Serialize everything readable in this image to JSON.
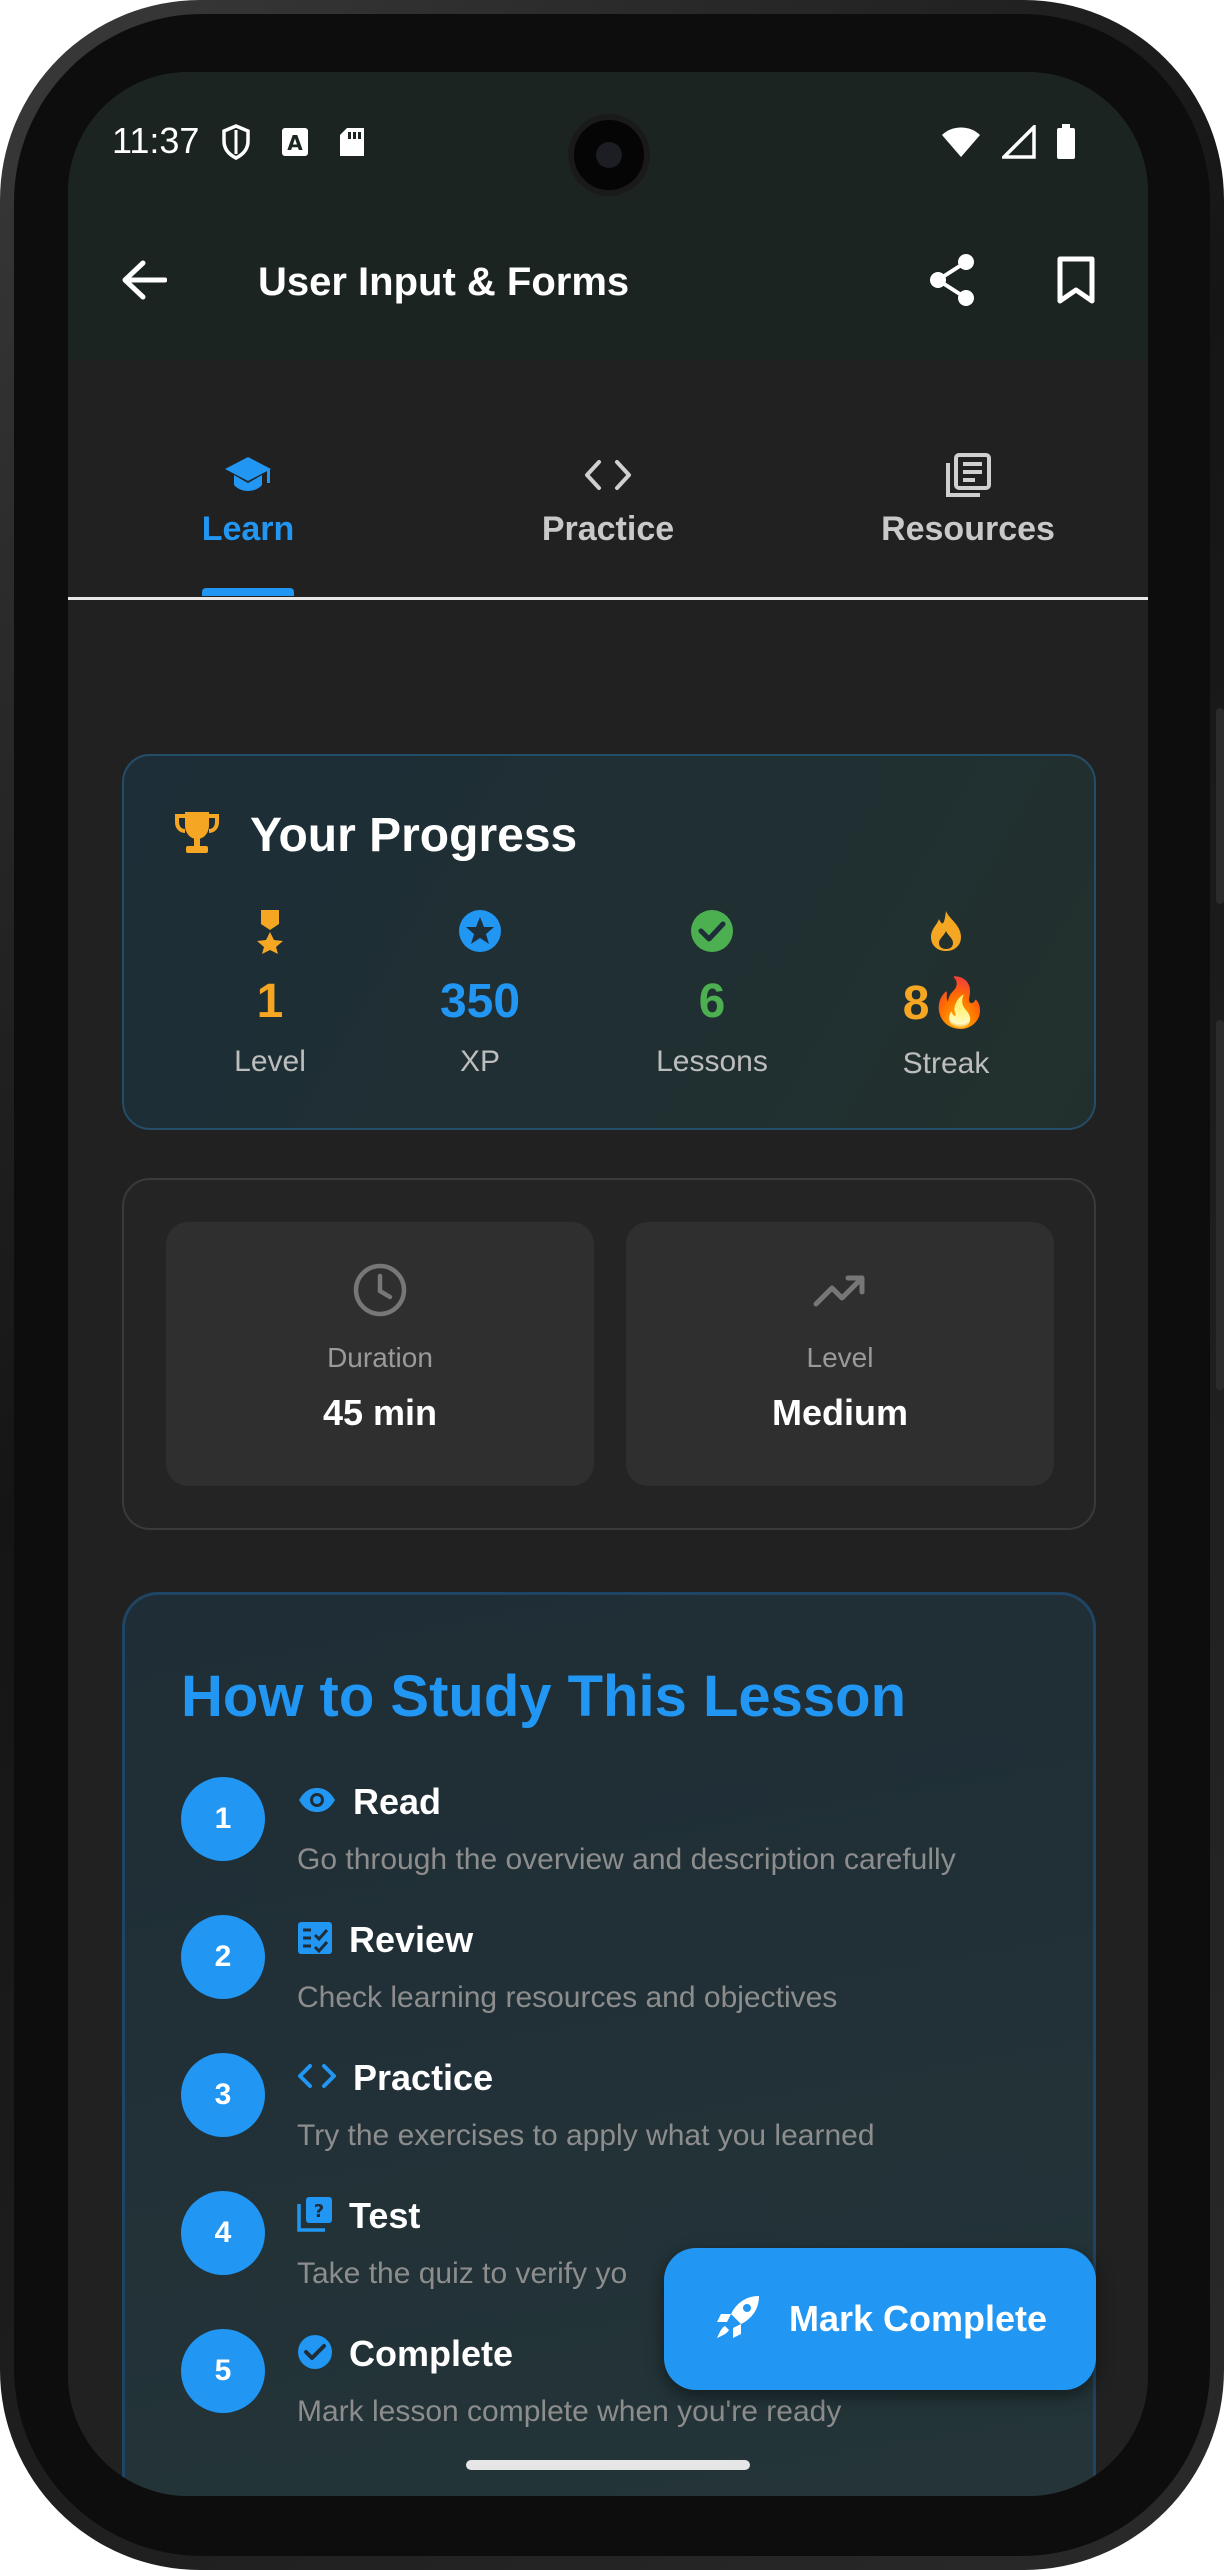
{
  "status_bar": {
    "time": "11:37",
    "left_icons": [
      "shield-icon",
      "font-a-icon",
      "sd-card-icon"
    ],
    "right_icons": [
      "wifi-icon",
      "signal-icon",
      "battery-icon"
    ]
  },
  "app_bar": {
    "title": "User Input & Forms",
    "actions": [
      "share-icon",
      "bookmark-icon"
    ]
  },
  "tabs": [
    {
      "label": "Learn",
      "icon": "school-icon",
      "active": true
    },
    {
      "label": "Practice",
      "icon": "code-icon",
      "active": false
    },
    {
      "label": "Resources",
      "icon": "library-icon",
      "active": false
    }
  ],
  "progress": {
    "title": "Your Progress",
    "stats": [
      {
        "value": "1",
        "label": "Level",
        "color": "#f5a623",
        "icon": "medal-icon"
      },
      {
        "value": "350",
        "label": "XP",
        "color": "#2196f3",
        "icon": "star-icon"
      },
      {
        "value": "6",
        "label": "Lessons",
        "color": "#4caf50",
        "icon": "check-circle-icon"
      },
      {
        "value": "8🔥",
        "label": "Streak",
        "color": "#f5a623",
        "icon": "fire-icon"
      }
    ]
  },
  "info": {
    "duration_label": "Duration",
    "duration_value": "45 min",
    "level_label": "Level",
    "level_value": "Medium"
  },
  "study": {
    "title": "How to Study This Lesson",
    "steps": [
      {
        "num": "1",
        "title": "Read",
        "desc": "Go through the overview and description carefully",
        "icon": "eye-icon"
      },
      {
        "num": "2",
        "title": "Review",
        "desc": "Check learning resources and objectives",
        "icon": "checklist-icon"
      },
      {
        "num": "3",
        "title": "Practice",
        "desc": "Try the exercises to apply what you learned",
        "icon": "code-icon"
      },
      {
        "num": "4",
        "title": "Test",
        "desc": "Take the quiz to verify yo",
        "icon": "quiz-icon"
      },
      {
        "num": "5",
        "title": "Complete",
        "desc": "Mark lesson complete when you're ready",
        "icon": "verified-icon"
      }
    ]
  },
  "fab": {
    "label": "Mark Complete",
    "icon": "rocket-icon"
  },
  "colors": {
    "accent": "#2196f3",
    "gold": "#f5a623",
    "green": "#4caf50",
    "background": "#212121",
    "bar": "#1c2422"
  }
}
